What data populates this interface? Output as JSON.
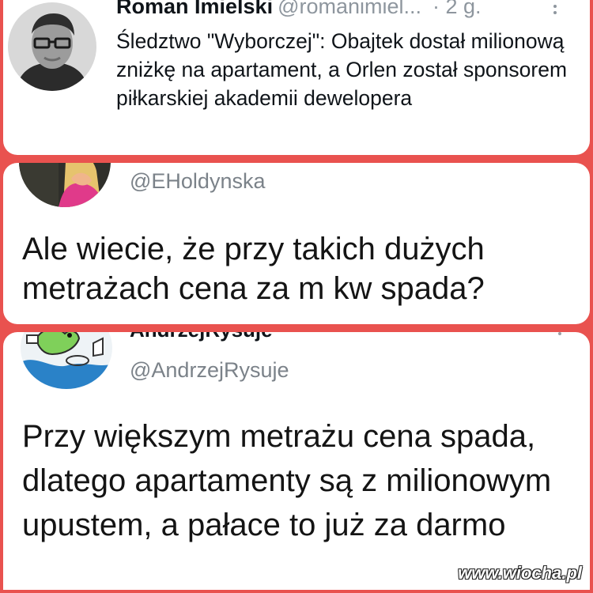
{
  "tweets": [
    {
      "author_name": "Roman Imielski",
      "handle": "@romanimiel...",
      "time": "· 2 g.",
      "text": "Śledztwo \"Wyborczej\": Obajtek dostał milionową zniżkę na apartament, a Orlen został sponsorem piłkarskiej akademii dewelopera"
    },
    {
      "handle": "@EHoldynska",
      "text": "Ale wiecie, że przy takich dużych metrażach cena za m kw spada?"
    },
    {
      "author_name_partial": "AndrzejRysuje",
      "handle": "@AndrzejRysuje",
      "text": "Przy większym metrażu cena spada, dlatego apartamenty są z milionowym upustem, a pałace to już za darmo"
    }
  ],
  "watermark": "www.wiocha.pl",
  "icons": [
    "more-options-icon",
    "avatar"
  ],
  "colors": {
    "background": "#e9524f",
    "card": "#ffffff",
    "text": "#0f1419",
    "secondary_text": "#7b8289"
  }
}
